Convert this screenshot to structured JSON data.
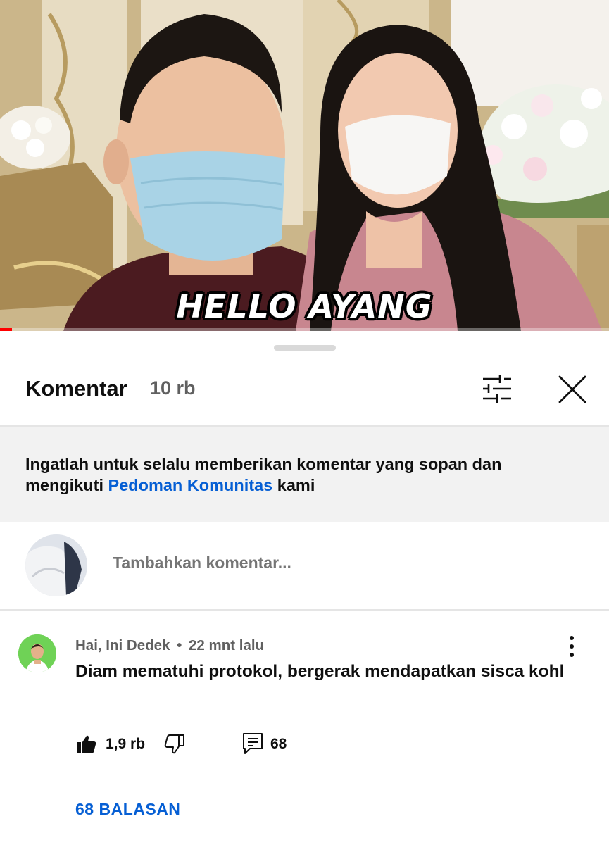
{
  "video": {
    "caption": "HELLO AYANG",
    "progress_fraction": 0.02
  },
  "sheet": {
    "title": "Komentar",
    "count": "10 rb",
    "sort_icon": "sliders-icon",
    "close_icon": "close-icon"
  },
  "guidelines": {
    "text_before": "Ingatlah untuk selalu memberikan komentar yang sopan dan mengikuti ",
    "link": "Pedoman Komunitas",
    "text_after": " kami"
  },
  "add_comment": {
    "placeholder": "Tambahkan komentar..."
  },
  "comments": [
    {
      "author": "Hai, Ini Dedek",
      "separator": "•",
      "time": "22 mnt lalu",
      "text": "Diam mematuhi protokol, bergerak mendapatkan sisca kohl",
      "likes": "1,9 rb",
      "reply_count": "68",
      "replies_link": "68 BALASAN"
    }
  ],
  "colors": {
    "link": "#065fd4",
    "progress": "#ff0000",
    "secondary_text": "#606060",
    "banner_bg": "#f2f2f2"
  }
}
